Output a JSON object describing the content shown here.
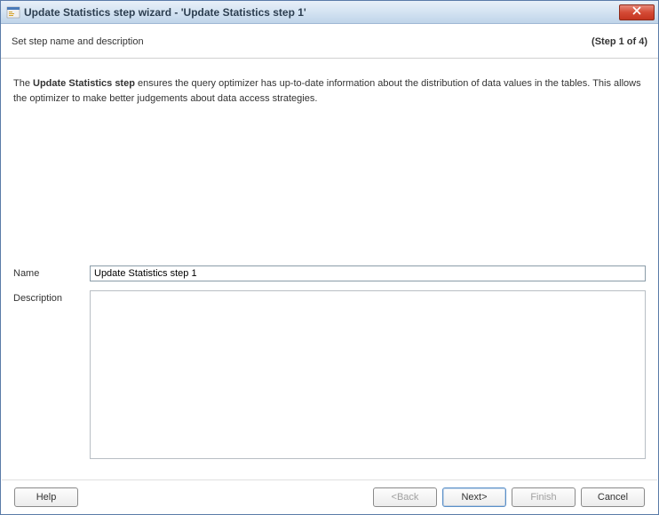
{
  "window": {
    "title": "Update Statistics step wizard - 'Update Statistics step 1'"
  },
  "header": {
    "title": "Set step name and description",
    "step_indicator": "(Step 1 of 4)"
  },
  "intro": {
    "prefix": "The ",
    "bold": "Update Statistics step",
    "suffix": " ensures the query optimizer has up-to-date information about the distribution of data values in the tables. This allows the optimizer to make better judgements about data access strategies."
  },
  "form": {
    "name_label": "Name",
    "name_value": "Update Statistics step 1",
    "description_label": "Description",
    "description_value": ""
  },
  "buttons": {
    "help": "Help",
    "back": "<Back",
    "next": "Next>",
    "finish": "Finish",
    "cancel": "Cancel"
  }
}
